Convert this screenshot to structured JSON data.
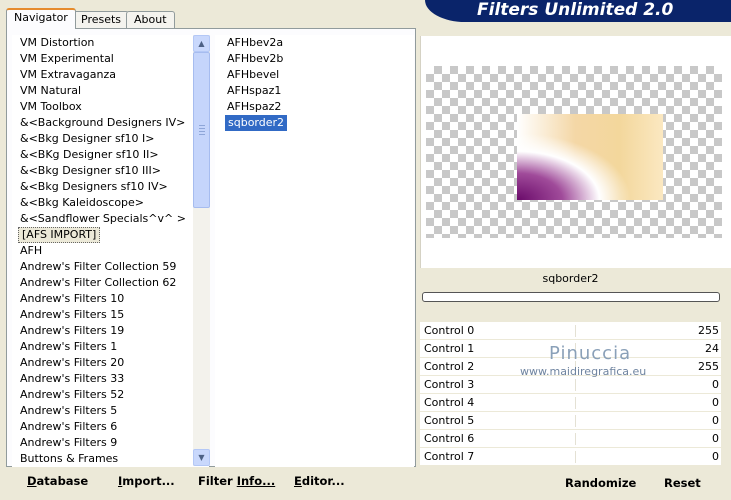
{
  "tabs": [
    {
      "label": "Navigator",
      "active": true
    },
    {
      "label": "Presets",
      "active": false
    },
    {
      "label": "About",
      "active": false
    }
  ],
  "title": "Filters Unlimited 2.0",
  "categories": [
    "VM Distortion",
    "VM Experimental",
    "VM Extravaganza",
    "VM Natural",
    "VM Toolbox",
    "&<Background Designers IV>",
    "&<Bkg Designer sf10 I>",
    "&<BKg Designer sf10 II>",
    "&<Bkg Designer sf10 III>",
    "&<Bkg Designers sf10 IV>",
    "&<Bkg Kaleidoscope>",
    "&<Sandflower Specials^v^ >",
    "[AFS IMPORT]",
    "AFH",
    "Andrew's Filter Collection 59",
    "Andrew's Filter Collection 62",
    "Andrew's Filters 10",
    "Andrew's Filters 15",
    "Andrew's Filters 19",
    "Andrew's Filters 1",
    "Andrew's Filters 20",
    "Andrew's Filters 33",
    "Andrew's Filters 52",
    "Andrew's Filters 5",
    "Andrew's Filters 6",
    "Andrew's Filters 9",
    "Buttons & Frames"
  ],
  "selected_category": "[AFS IMPORT]",
  "filters": [
    "AFHbev2a",
    "AFHbev2b",
    "AFHbevel",
    "AFHspaz1",
    "AFHspaz2",
    "sqborder2"
  ],
  "selected_filter": "sqborder2",
  "bottom_buttons": [
    {
      "accel": "D",
      "rest": "atabase"
    },
    {
      "accel": "I",
      "rest": "mport..."
    },
    {
      "accel": "Filter ",
      "rest": "Info...",
      "accel_is_prefix": true
    },
    {
      "accel": "E",
      "rest": "ditor..."
    }
  ],
  "preview_filter_name": "sqborder2",
  "progress": 0,
  "controls": [
    {
      "label": "Control 0",
      "value": "255"
    },
    {
      "label": "Control 1",
      "value": "24"
    },
    {
      "label": "Control 2",
      "value": "255"
    },
    {
      "label": "Control 3",
      "value": "0"
    },
    {
      "label": "Control 4",
      "value": "0"
    },
    {
      "label": "Control 5",
      "value": "0"
    },
    {
      "label": "Control 6",
      "value": "0"
    },
    {
      "label": "Control 7",
      "value": "0"
    }
  ],
  "watermark": {
    "name": "Pinuccia",
    "url": "www.maidiregrafica.eu"
  },
  "randomize_label": "Randomize",
  "reset_label": "Reset",
  "icons": {
    "scroll_up": "▲",
    "scroll_down": "▼"
  }
}
